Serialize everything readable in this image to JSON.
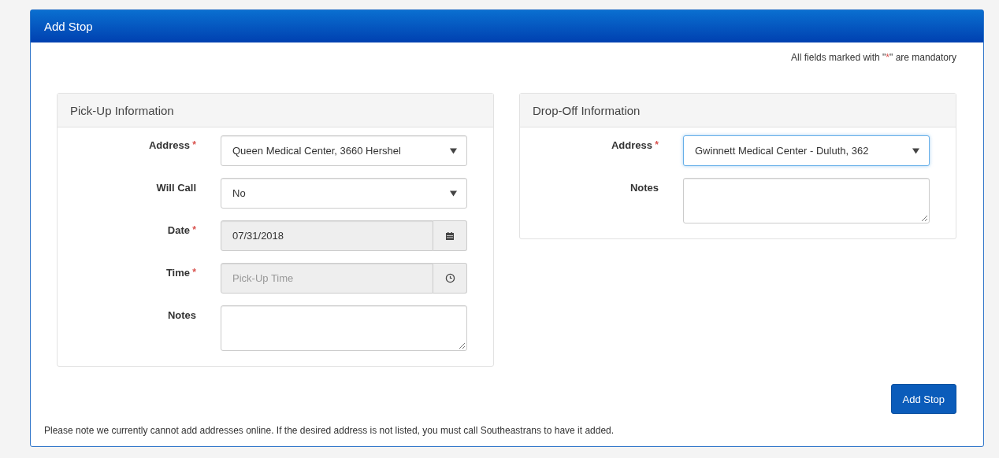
{
  "panel": {
    "title": "Add Stop"
  },
  "mandatory_note": {
    "before": "All fields marked with \"",
    "mark": "*",
    "after": "\" are mandatory"
  },
  "sections": [
    {
      "title": "Pick-Up Information",
      "fields": [
        {
          "kind": "select",
          "label": "Address",
          "required_mark": "*",
          "value": "Queen Medical Center, 3660 Hershel",
          "focused": false,
          "disabled": false
        },
        {
          "kind": "select",
          "label": "Will Call",
          "value": "No",
          "focused": false,
          "disabled": false
        },
        {
          "kind": "date",
          "label": "Date",
          "required_mark": "*",
          "value": "07/31/2018",
          "focused": false,
          "disabled": true
        },
        {
          "kind": "time",
          "label": "Time",
          "required_mark": "*",
          "placeholder": "Pick-Up Time",
          "focused": false,
          "disabled": true
        },
        {
          "kind": "textarea",
          "label": "Notes",
          "focused": false,
          "disabled": false
        }
      ]
    },
    {
      "title": "Drop-Off Information",
      "fields": [
        {
          "kind": "select",
          "label": "Address",
          "required_mark": "*",
          "value": "Gwinnett Medical Center - Duluth, 362",
          "focused": true,
          "disabled": false
        },
        {
          "kind": "textarea",
          "label": "Notes",
          "focused": false,
          "disabled": false
        }
      ]
    }
  ],
  "submit_button": "Add Stop",
  "footer_note": "Please note we currently cannot add addresses online. If the desired address is not listed, you must call Southeastrans to have it added."
}
